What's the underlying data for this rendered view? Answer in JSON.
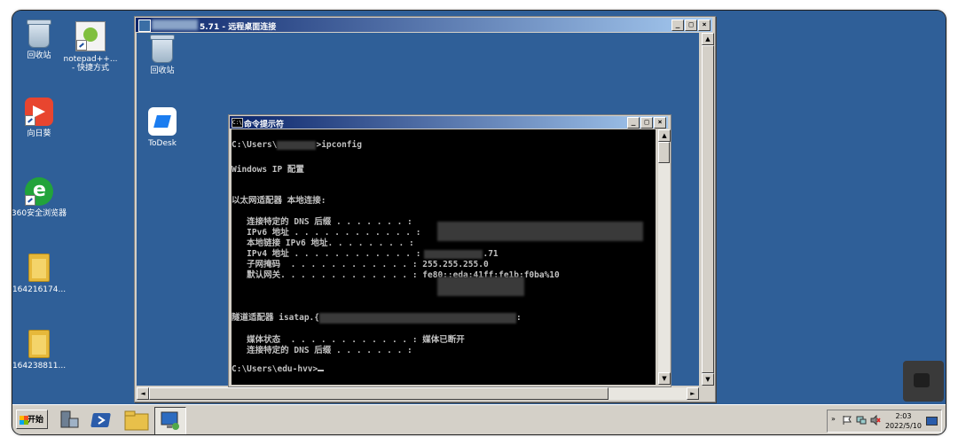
{
  "desktop": {
    "icons": [
      {
        "label": "回收站"
      },
      {
        "label": "notepad++... - 快捷方式"
      },
      {
        "label": "向日葵"
      },
      {
        "label": "360安全浏览器"
      },
      {
        "label": "164216174..."
      },
      {
        "label": "164238811..."
      }
    ]
  },
  "rdp": {
    "title": "5.71 - 远程桌面连接",
    "icons": [
      {
        "label": "回收站"
      },
      {
        "label": "ToDesk"
      }
    ]
  },
  "cmd": {
    "title": "命令提示符",
    "icon_text": "C:\\",
    "lines": {
      "l1a": "C:\\Users\\",
      "l1b": ">ipconfig",
      "l2": "Windows IP 配置",
      "l3": "以太网适配器 本地连接:",
      "l4": "   连接特定的 DNS 后缀 . . . . . . . :",
      "l5": "   IPv6 地址 . . . . . . . . . . . . :",
      "l6": "   本地链接 IPv6 地址. . . . . . . . :",
      "l7a": "   IPv4 地址 . . . . . . . . . . . . :",
      "l7b": ".71",
      "l8": "   子网掩码  . . . . . . . . . . . . : 255.255.255.0",
      "l9": "   默认网关. . . . . . . . . . . . . : fe80::eda:41ff:fe1b:f0ba%10",
      "l10a": "隧道适配器 isatap.{",
      "l10b": ":",
      "l11": "   媒体状态  . . . . . . . . . . . . : 媒体已断开",
      "l12": "   连接特定的 DNS 后缀 . . . . . . . :",
      "l13": "C:\\Users\\edu-hvv>"
    }
  },
  "taskbar": {
    "start_label": "开始",
    "time": "2:03",
    "date": "2022/5/10",
    "tray_chevron": "»"
  },
  "window_buttons": {
    "minimize": "_",
    "maximize": "□",
    "close": "×"
  }
}
